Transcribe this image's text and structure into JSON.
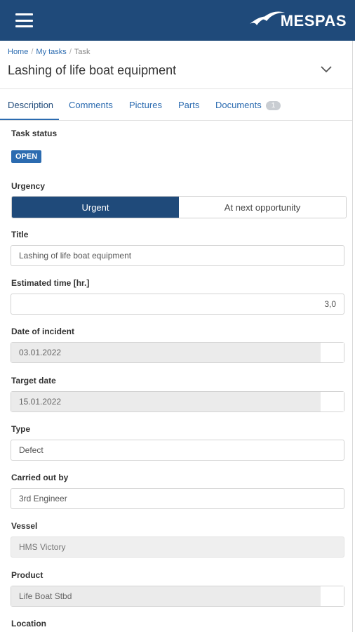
{
  "brand": {
    "logo_text": "MESPAS",
    "primary": "#1f4a7a",
    "accent": "#2b6bb0"
  },
  "breadcrumb": {
    "home": "Home",
    "my_tasks": "My tasks",
    "current": "Task"
  },
  "page_title": "Lashing of life boat equipment",
  "tabs": [
    {
      "label": "Description",
      "active": true
    },
    {
      "label": "Comments"
    },
    {
      "label": "Pictures"
    },
    {
      "label": "Parts"
    },
    {
      "label": "Documents",
      "badge": "1"
    }
  ],
  "form": {
    "task_status": {
      "label": "Task status",
      "value": "OPEN"
    },
    "urgency": {
      "label": "Urgency",
      "options": [
        "Urgent",
        "At next opportunity"
      ],
      "selected": "Urgent"
    },
    "title": {
      "label": "Title",
      "value": "Lashing of life boat equipment"
    },
    "estimated_time": {
      "label": "Estimated time [hr.]",
      "value": "3,0"
    },
    "date_of_incident": {
      "label": "Date of incident",
      "value": "03.01.2022"
    },
    "target_date": {
      "label": "Target date",
      "value": "15.01.2022"
    },
    "type": {
      "label": "Type",
      "value": "Defect"
    },
    "carried_out_by": {
      "label": "Carried out by",
      "value": "3rd Engineer"
    },
    "vessel": {
      "label": "Vessel",
      "value": "HMS Victory"
    },
    "product": {
      "label": "Product",
      "value": "Life Boat Stbd"
    },
    "location": {
      "label": "Location"
    }
  },
  "icons": [
    "menu-icon",
    "chevron-down-icon",
    "mespas-logo"
  ]
}
